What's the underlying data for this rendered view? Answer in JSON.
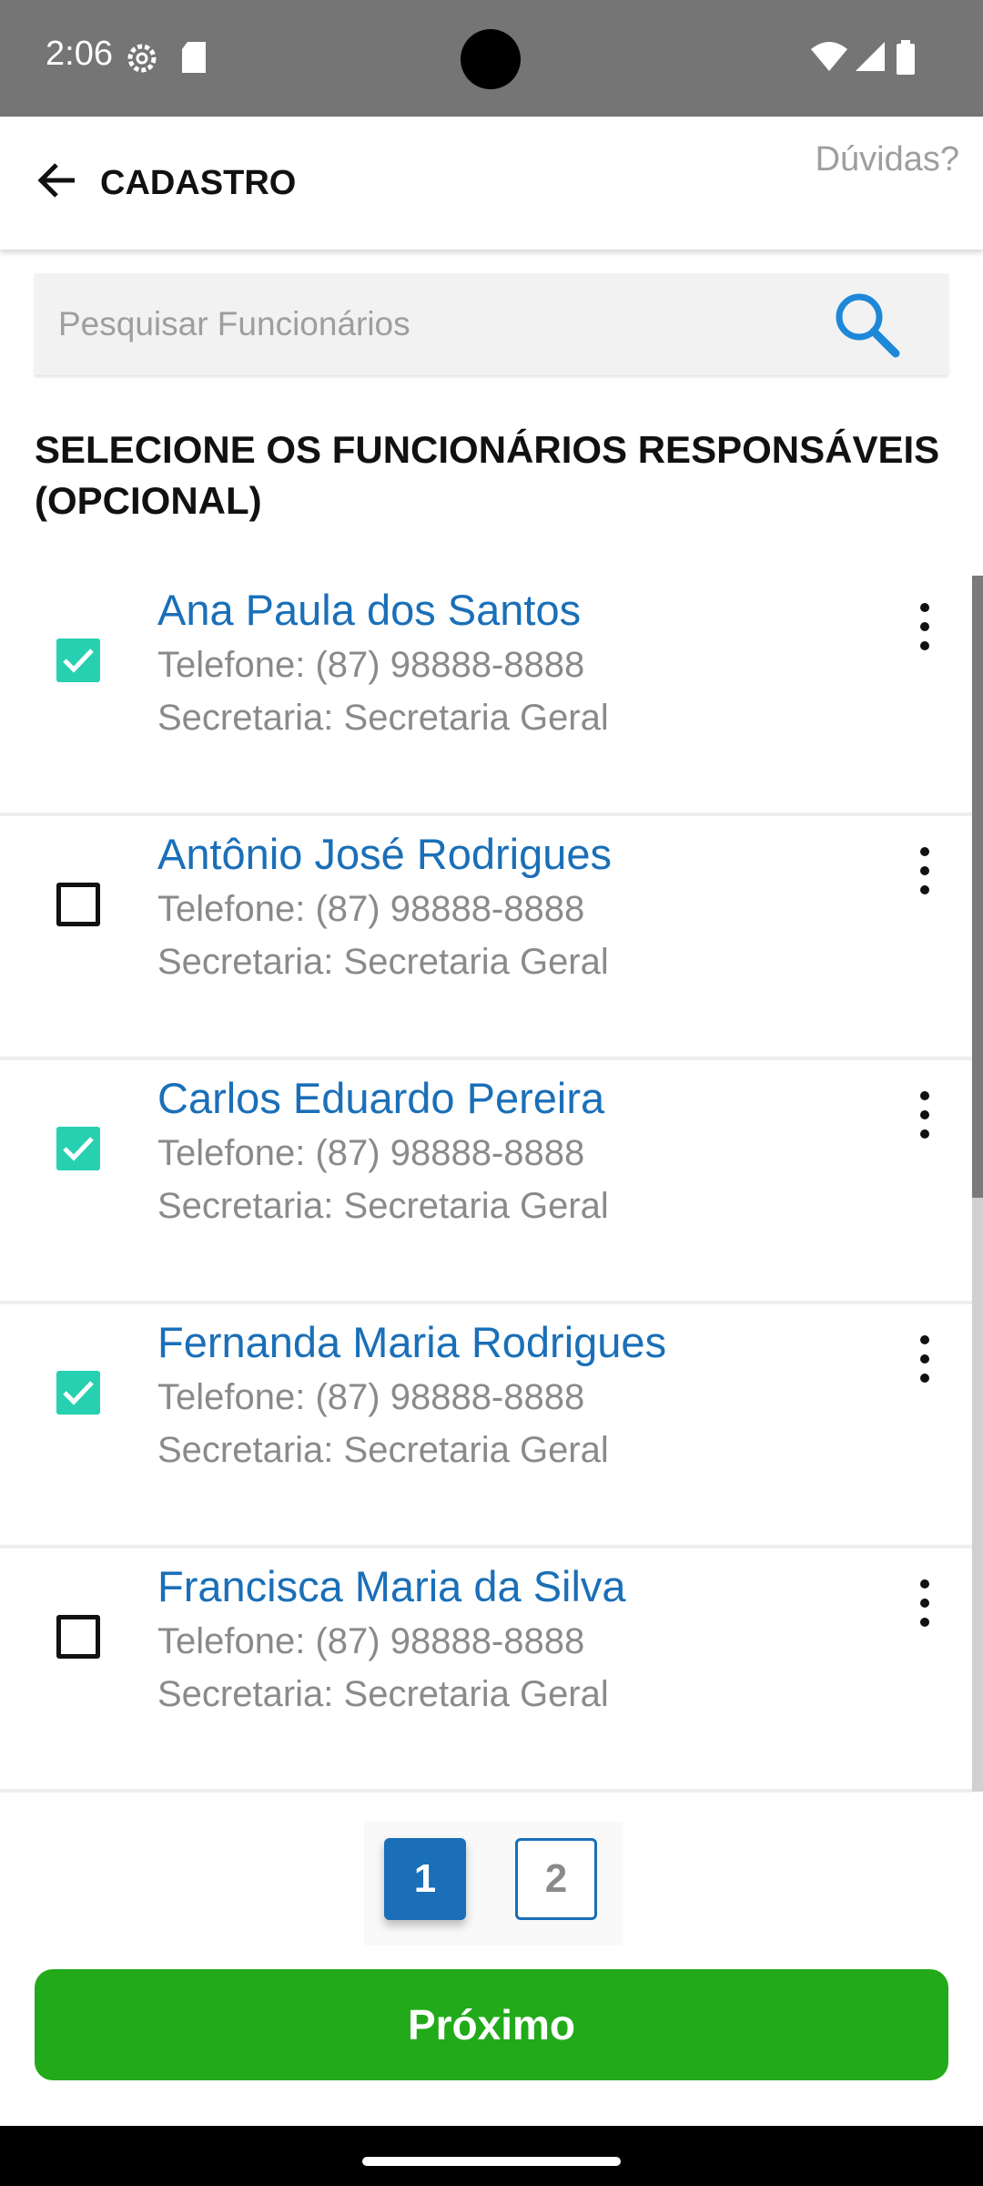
{
  "status_bar": {
    "time": "2:06"
  },
  "header": {
    "title": "CADASTRO",
    "help_label": "Dúvidas?"
  },
  "search": {
    "placeholder": "Pesquisar Funcionários",
    "value": ""
  },
  "section_title": "SELECIONE OS FUNCIONÁRIOS RESPONSÁVEIS (OPCIONAL)",
  "employees": [
    {
      "name": "Ana Paula dos Santos",
      "phone": "Telefone: (87) 98888-8888",
      "department": "Secretaria: Secretaria Geral",
      "selected": true
    },
    {
      "name": "Antônio José Rodrigues",
      "phone": "Telefone: (87) 98888-8888",
      "department": "Secretaria: Secretaria Geral",
      "selected": false
    },
    {
      "name": "Carlos Eduardo Pereira",
      "phone": "Telefone: (87) 98888-8888",
      "department": "Secretaria: Secretaria Geral",
      "selected": true
    },
    {
      "name": "Fernanda Maria Rodrigues",
      "phone": "Telefone: (87) 98888-8888",
      "department": "Secretaria: Secretaria Geral",
      "selected": true
    },
    {
      "name": "Francisca Maria da Silva",
      "phone": "Telefone: (87) 98888-8888",
      "department": "Secretaria: Secretaria Geral",
      "selected": false
    }
  ],
  "pagination": {
    "pages": [
      "1",
      "2"
    ],
    "current": "1"
  },
  "next_button": {
    "label": "Próximo"
  },
  "colors": {
    "accent": "#1a6fb8",
    "checkbox_checked": "#26d0b0",
    "next_button": "#22aa1a",
    "status_bar": "#757575"
  }
}
